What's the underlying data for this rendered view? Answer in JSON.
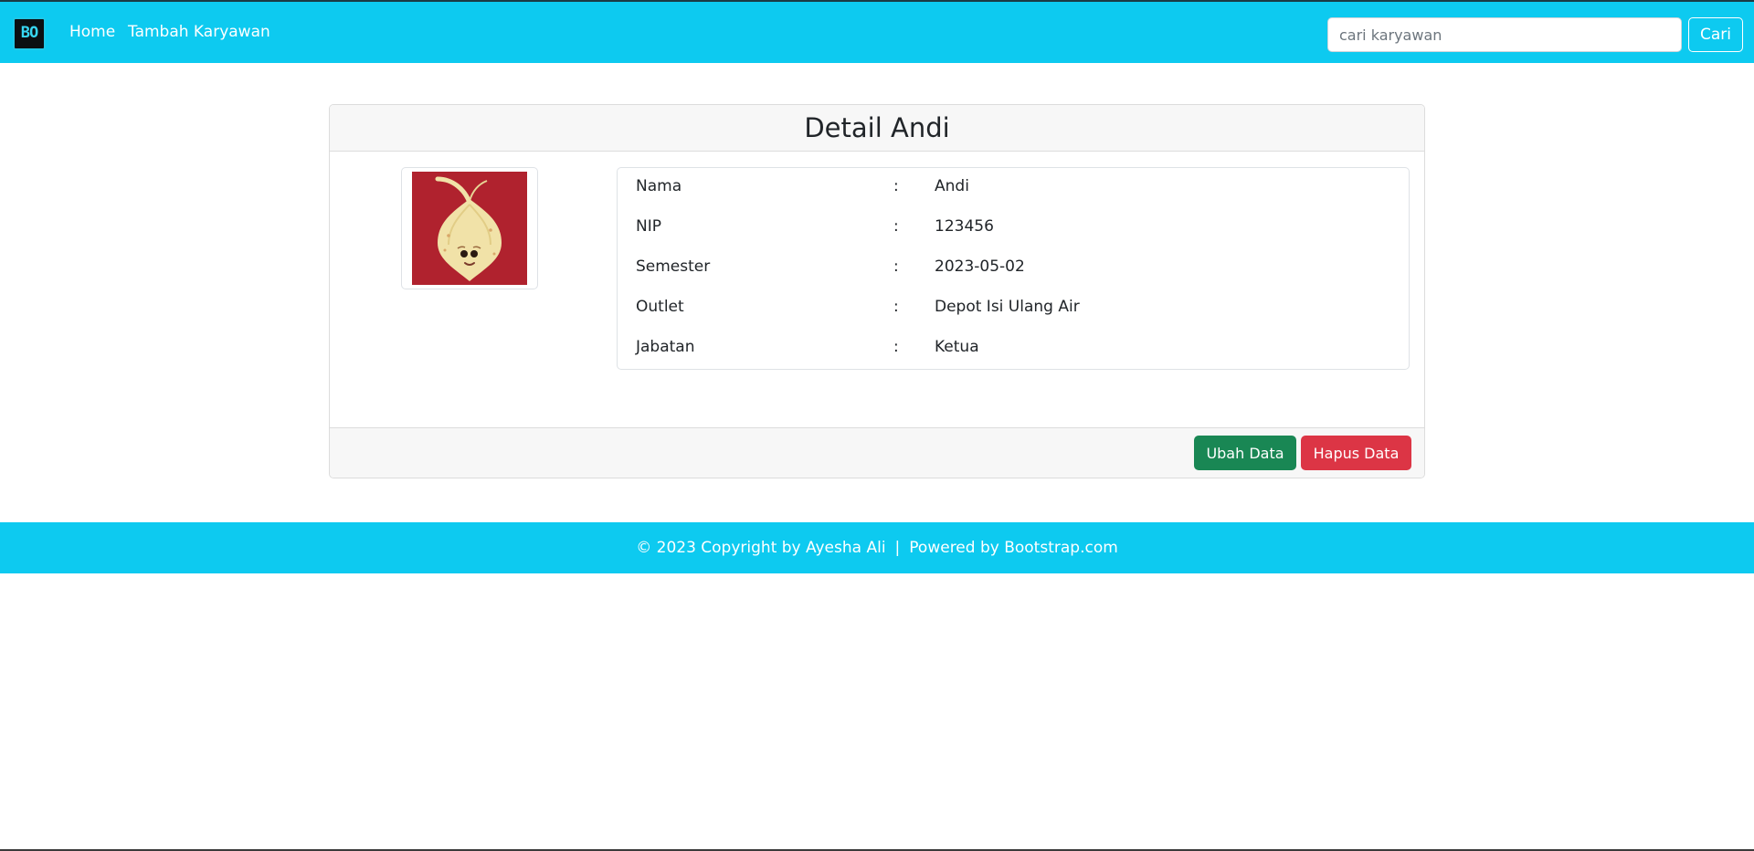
{
  "navbar": {
    "brand_text": "BO",
    "home_label": "Home",
    "add_employee_label": "Tambah Karyawan",
    "search_placeholder": "cari karyawan",
    "search_value": "",
    "search_button_label": "Cari",
    "bg_color": "#0dcaf0"
  },
  "detail": {
    "title": "Detail Andi",
    "photo_icon": "onion-mascot-image",
    "fields": [
      {
        "label": "Nama",
        "separator": ":",
        "value": "Andi"
      },
      {
        "label": "NIP",
        "separator": ":",
        "value": "123456"
      },
      {
        "label": "Semester",
        "separator": ":",
        "value": "2023-05-02"
      },
      {
        "label": "Outlet",
        "separator": ":",
        "value": "Depot Isi Ulang Air"
      },
      {
        "label": "Jabatan",
        "separator": ":",
        "value": "Ketua"
      }
    ],
    "edit_button_label": "Ubah Data",
    "delete_button_label": "Hapus Data"
  },
  "footer": {
    "copyright": "© 2023 Copyright by Ayesha Ali",
    "separator": "|",
    "powered_by": "Powered by Bootstrap.com"
  },
  "colors": {
    "accent": "#0dcaf0",
    "success": "#198754",
    "danger": "#dc3545",
    "photo_bg": "#b0222e"
  }
}
